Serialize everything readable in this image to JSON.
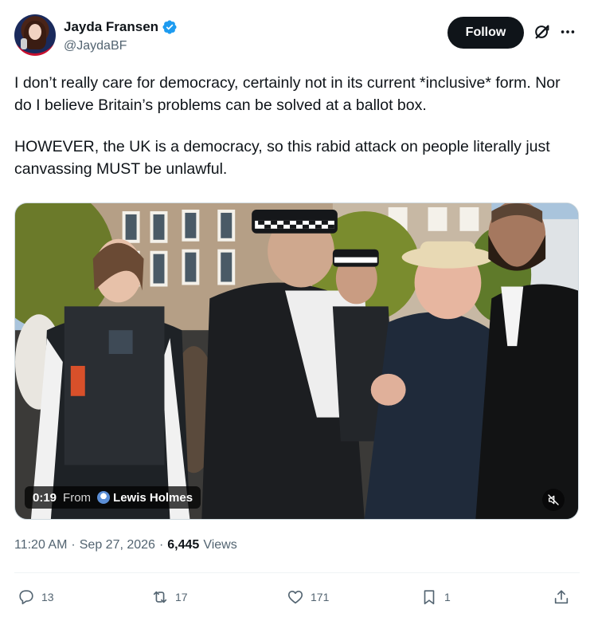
{
  "author": {
    "display_name": "Jayda Fransen",
    "handle": "@JaydaBF",
    "verified": true
  },
  "follow_button": {
    "label": "Follow"
  },
  "tweet": {
    "paragraphs": [
      "I don’t really care for democracy, certainly not in its current *inclusive* form. Nor do I believe Britain’s problems can be solved at a ballot box.",
      "HOWEVER, the UK is a democracy, so this rabid attack on people literally just canvassing MUST be unlawful."
    ]
  },
  "media": {
    "duration": "0:19",
    "from_label": "From",
    "source_name": "Lewis Holmes"
  },
  "meta": {
    "time": "11:20 AM",
    "separator": "·",
    "date": "Sep 27, 2026",
    "views_count": "6,445",
    "views_label": "Views"
  },
  "actions": {
    "replies": "13",
    "reposts": "17",
    "likes": "171",
    "bookmarks": "1"
  },
  "colors": {
    "verified_blue": "#1d9bf0",
    "text_primary": "#0f1419",
    "text_secondary": "#536471",
    "follow_bg": "#0f1419"
  }
}
